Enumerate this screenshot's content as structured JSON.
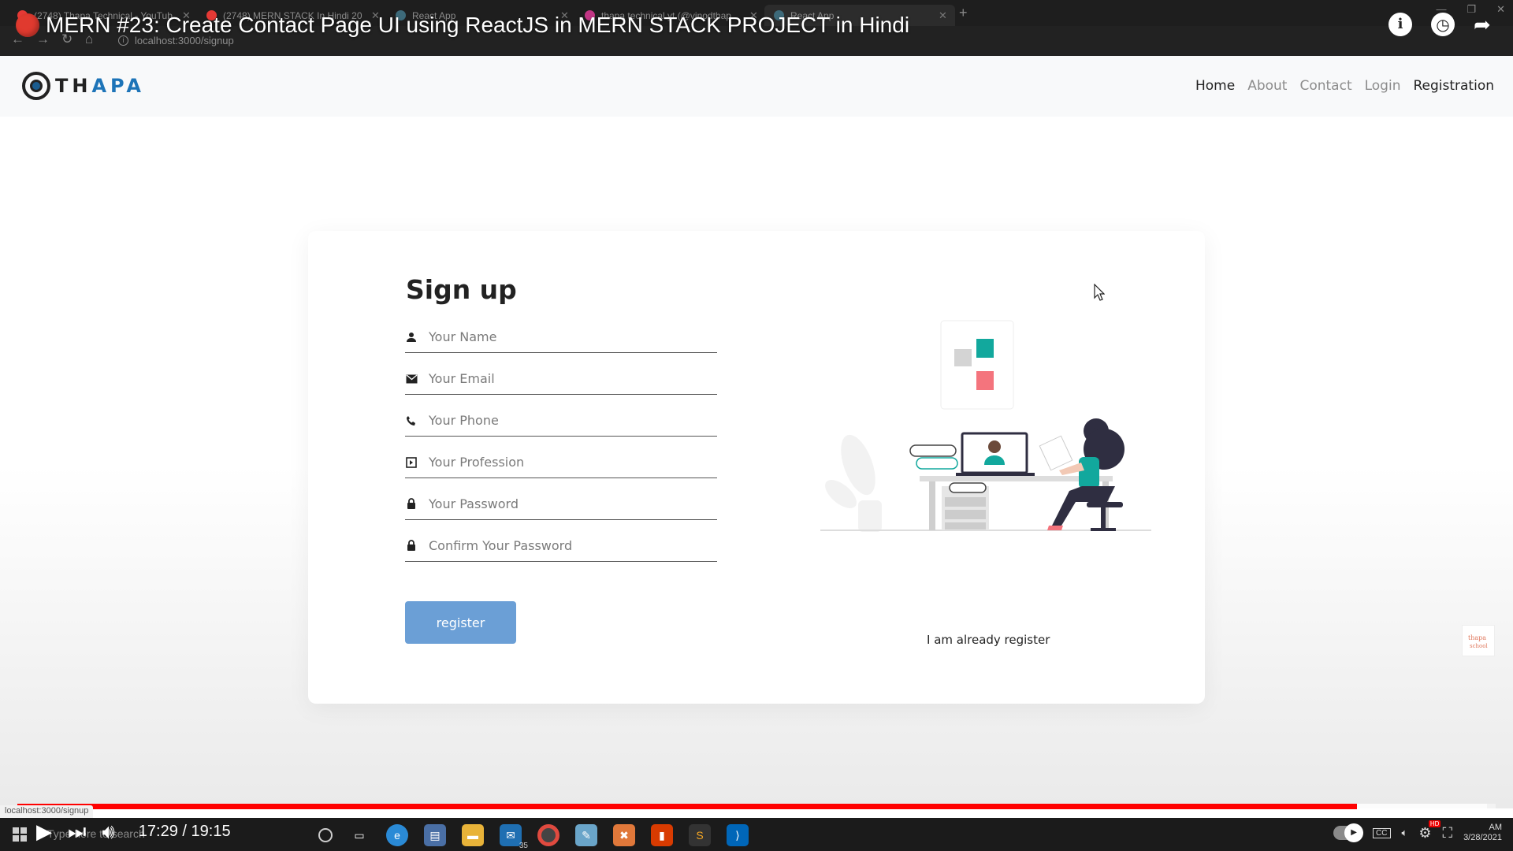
{
  "browser": {
    "tabs": [
      {
        "label": "(2748) Thapa Technical - YouTub",
        "favicon_color": "#e53935",
        "active": false
      },
      {
        "label": "(2748) MERN STACK In Hindi 20",
        "favicon_color": "#e53935",
        "active": false
      },
      {
        "label": "React App",
        "favicon_color": "#61dafb",
        "active": false
      },
      {
        "label": "thapa technical yt (@vinodthap",
        "favicon_color": "#c13584",
        "active": false
      },
      {
        "label": "React App",
        "favicon_color": "#61dafb",
        "active": true
      }
    ],
    "url": "localhost:3000/signup"
  },
  "video": {
    "title": "MERN #23: Create Contact Page UI using ReactJS in MERN STACK PROJECT in Hindi",
    "current_time": "17:29",
    "duration": "19:15",
    "time_display": "17:29 / 19:15",
    "played_fraction": 0.906,
    "loaded_fraction": 0.994,
    "quality_badge": "HD"
  },
  "site": {
    "logo": {
      "part1": "TH",
      "part2": "APA"
    },
    "nav": {
      "home": "Home",
      "about": "About",
      "contact": "Contact",
      "login": "Login",
      "registration": "Registration"
    },
    "signup": {
      "title": "Sign up",
      "fields": {
        "name": "Your Name",
        "email": "Your Email",
        "phone": "Your Phone",
        "profession": "Your Profession",
        "password": "Your Password",
        "confirm_password": "Confirm Your Password"
      },
      "register_button": "register",
      "already_link": "I am already register"
    },
    "colors": {
      "accent": "#6b9fd6",
      "logo_blue": "#1d74b8",
      "teal": "#12a89d",
      "pink": "#f4747d"
    }
  },
  "status_bar": {
    "url": "localhost:3000/signup"
  },
  "taskbar": {
    "search_placeholder": "Type here to search",
    "mail_badge": "35",
    "clock_time": "AM",
    "clock_date": "3/28/2021"
  }
}
